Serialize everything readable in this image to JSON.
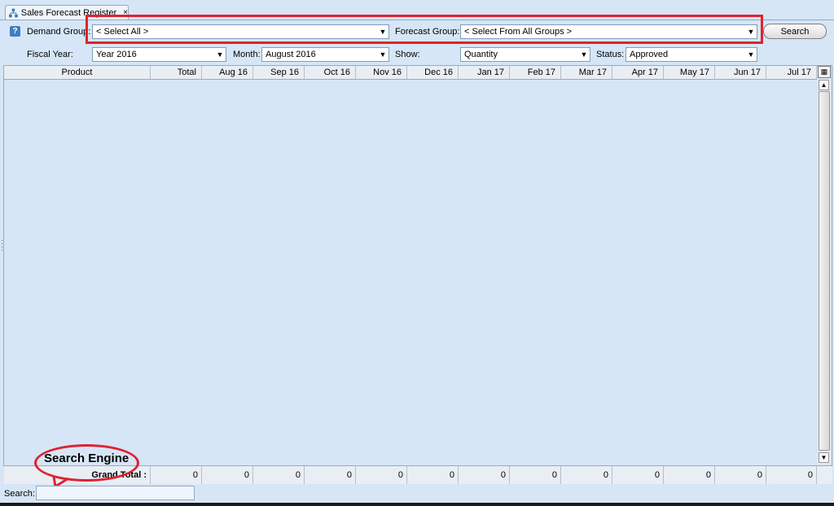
{
  "tab": {
    "title": "Sales Forecast Register",
    "close": "×"
  },
  "filters": {
    "demand_group_label": "Demand Group:",
    "demand_group_value": "< Select All >",
    "forecast_group_label": "Forecast Group:",
    "forecast_group_value": "< Select From All Groups >",
    "search_button": "Search",
    "fiscal_year_label": "Fiscal Year:",
    "fiscal_year_value": "Year 2016",
    "month_label": "Month:",
    "month_value": "August 2016",
    "show_label": "Show:",
    "show_value": "Quantity",
    "status_label": "Status:",
    "status_value": "Approved",
    "help": "?"
  },
  "grid": {
    "columns": [
      "Product",
      "Total",
      "Aug 16",
      "Sep 16",
      "Oct 16",
      "Nov 16",
      "Dec 16",
      "Jan 17",
      "Feb 17",
      "Mar 17",
      "Apr 17",
      "May 17",
      "Jun 17",
      "Jul 17"
    ],
    "grand_total_label": "Grand Total :",
    "totals": [
      "0",
      "0",
      "0",
      "0",
      "0",
      "0",
      "0",
      "0",
      "0",
      "0",
      "0",
      "0",
      "0"
    ]
  },
  "footer": {
    "search_label": "Search:",
    "search_value": ""
  },
  "annotation": {
    "callout": "Search Engine"
  },
  "colors": {
    "background": "#d6e6f6",
    "highlight": "#e0222e"
  }
}
